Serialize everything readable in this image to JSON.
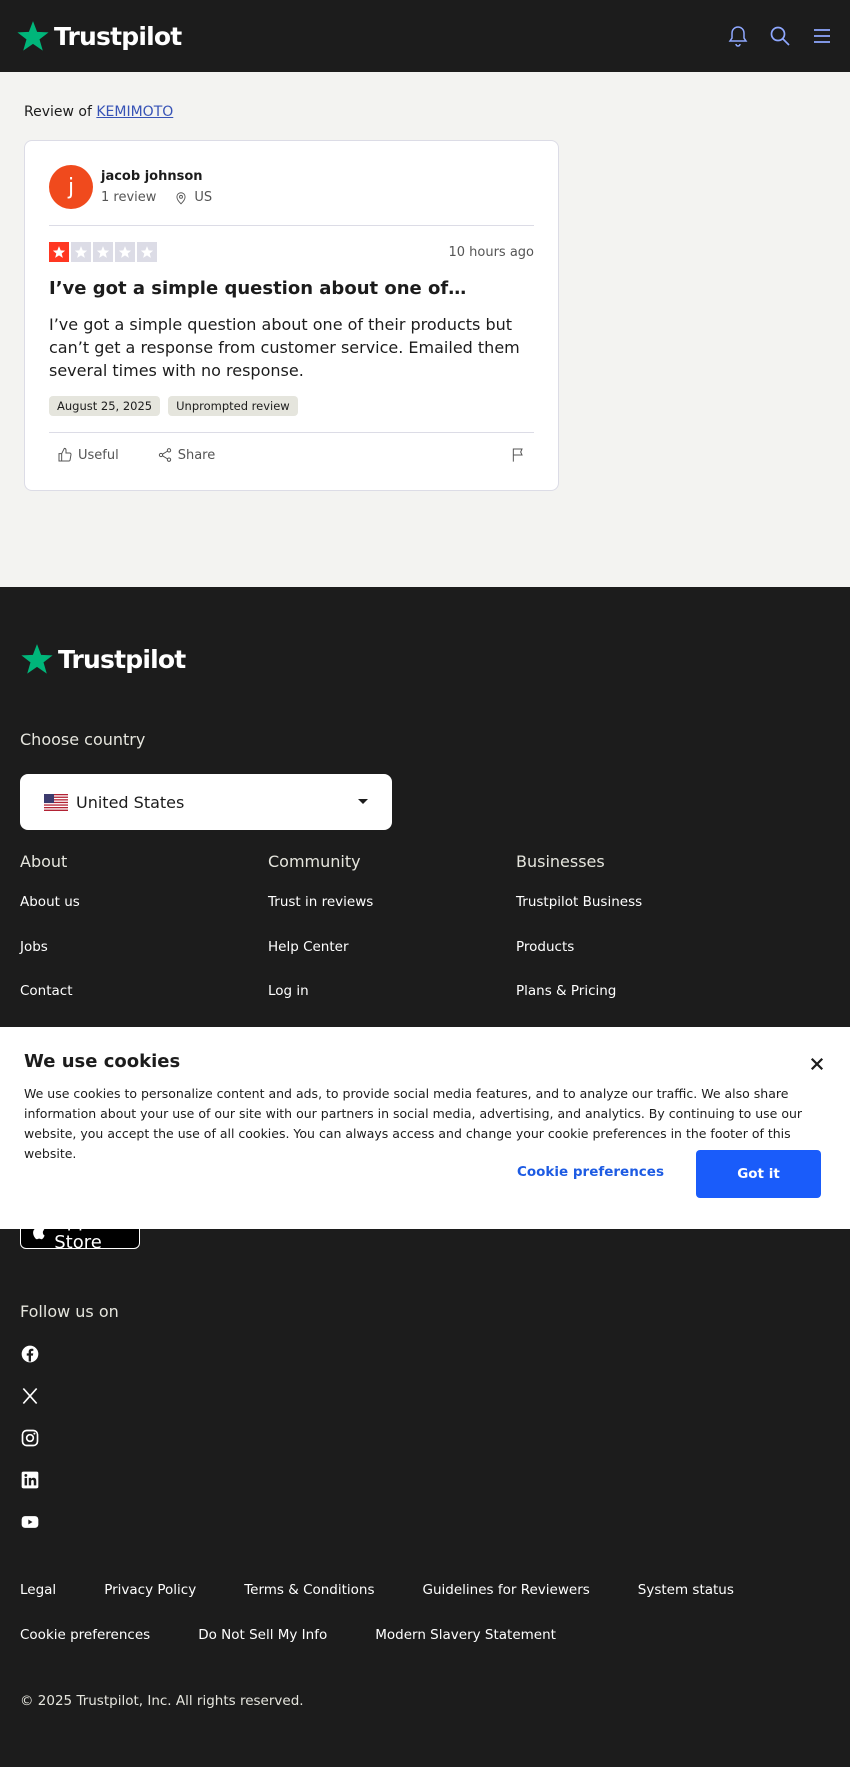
{
  "header": {
    "logo_text": "Trustpilot",
    "icons": [
      "bell-icon",
      "search-icon",
      "menu-icon"
    ]
  },
  "review_of": {
    "prefix": "Review of",
    "company": "KEMIMOTO"
  },
  "review": {
    "avatar_letter": "j",
    "avatar_color": "#f04a1d",
    "reviewer_name": "jacob johnson",
    "review_count": "1 review",
    "country": "US",
    "rating": 1,
    "max_rating": 5,
    "time_ago": "10 hours ago",
    "title": "I’ve got a simple question about one of…",
    "body": "I’ve got a simple question about one of their products but can’t get a response from customer service. Emailed them several times with no response.",
    "date_chip": "August 25, 2025",
    "type_chip": "Unprompted review",
    "useful_label": "Useful",
    "share_label": "Share"
  },
  "footer": {
    "logo_text": "Trustpilot",
    "choose_country": "Choose country",
    "country_selected": "United States",
    "columns": [
      {
        "heading": "About",
        "links": [
          "About us",
          "Jobs",
          "Contact"
        ]
      },
      {
        "heading": "Community",
        "links": [
          "Trust in reviews",
          "Help Center",
          "Log in"
        ]
      },
      {
        "heading": "Businesses",
        "links": [
          "Trustpilot Business",
          "Products",
          "Plans & Pricing"
        ]
      }
    ],
    "app_store": "App Store",
    "follow_us": "Follow us on",
    "social": [
      "facebook-icon",
      "x-icon",
      "instagram-icon",
      "linkedin-icon",
      "youtube-icon"
    ],
    "legal_row1": [
      "Legal",
      "Privacy Policy",
      "Terms & Conditions",
      "Guidelines for Reviewers",
      "System status"
    ],
    "legal_row2": [
      "Cookie preferences",
      "Do Not Sell My Info",
      "Modern Slavery Statement"
    ],
    "copyright": "© 2025 Trustpilot, Inc. All rights reserved."
  },
  "cookie": {
    "title": "We use cookies",
    "text": "We use cookies to personalize content and ads, to provide social media features, and to analyze our traffic. We also share information about your use of our site with our partners in social media, advertising, and analytics. By continuing to use our website, you accept the use of all cookies. You can always access and change your cookie preferences in the footer of this website.",
    "preferences_label": "Cookie preferences",
    "accept_label": "Got it"
  },
  "colors": {
    "brand_green": "#00b67a",
    "star_red": "#ff3722",
    "star_empty": "#dcdce6",
    "accent_blue": "#1a5cfa",
    "dark_bg": "#1c1c1c"
  }
}
